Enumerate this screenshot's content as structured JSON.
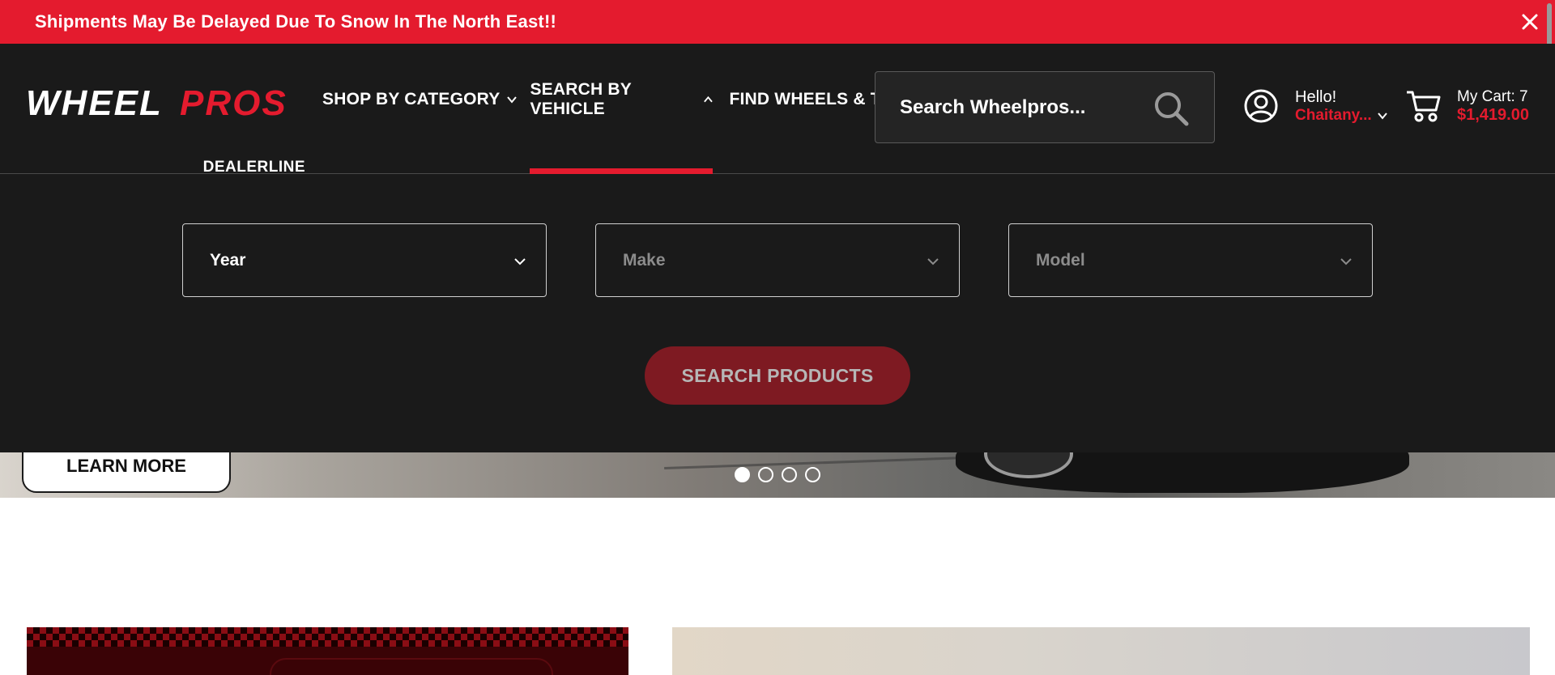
{
  "announcement": {
    "text": "Shipments May Be Delayed Due To Snow In The North East!!"
  },
  "brand": {
    "logo_primary": "WHEEL",
    "logo_accent": "PROS",
    "logo_sub": "DEALERLINE",
    "accent_color": "#e41b2e"
  },
  "nav": {
    "items": [
      {
        "label": "SHOP BY CATEGORY"
      },
      {
        "label": "SEARCH BY VEHICLE"
      },
      {
        "label": "FIND WHEELS & TIRES"
      }
    ]
  },
  "search": {
    "placeholder": "Search Wheelpros..."
  },
  "account": {
    "greeting": "Hello!",
    "name": "Chaitany..."
  },
  "cart": {
    "count_label": "My Cart: 7",
    "total": "$1,419.00"
  },
  "vehicle_search": {
    "year": "Year",
    "make": "Make",
    "model": "Model",
    "button": "SEARCH PRODUCTS"
  },
  "hero": {
    "cta": "LEARN MORE",
    "slides": 4,
    "active_slide": 1
  }
}
